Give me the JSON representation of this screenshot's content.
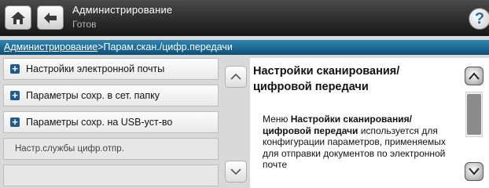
{
  "header": {
    "title": "Администрирование",
    "status": "Готов",
    "help_label": "?"
  },
  "breadcrumb": {
    "parent": "Администрирование",
    "separator": ">",
    "current": "Парам.скан./цифр.передачи"
  },
  "menu": {
    "items": [
      {
        "label": "Настройки электронной почты",
        "icon": "plus-icon"
      },
      {
        "label": "Параметры сохр. в сет. папку",
        "icon": "plus-icon"
      },
      {
        "label": "Параметры сохр. на USB-уст-во",
        "icon": "plus-icon"
      },
      {
        "label": "Настр.службы цифр.отпр."
      },
      {
        "label": ""
      }
    ]
  },
  "help_panel": {
    "title": "Настройки сканирования/цифровой передачи",
    "body_prefix": "Меню ",
    "body_bold": "Настройки сканирования/цифровой передачи",
    "body_suffix": " используется для конфигурации параметров, применяемых для отправки документов по электронной почте"
  },
  "colors": {
    "breadcrumb_bar": "#1a6a99",
    "header_bg": "#2a2a2a",
    "bullet": "#1f5b8c"
  }
}
